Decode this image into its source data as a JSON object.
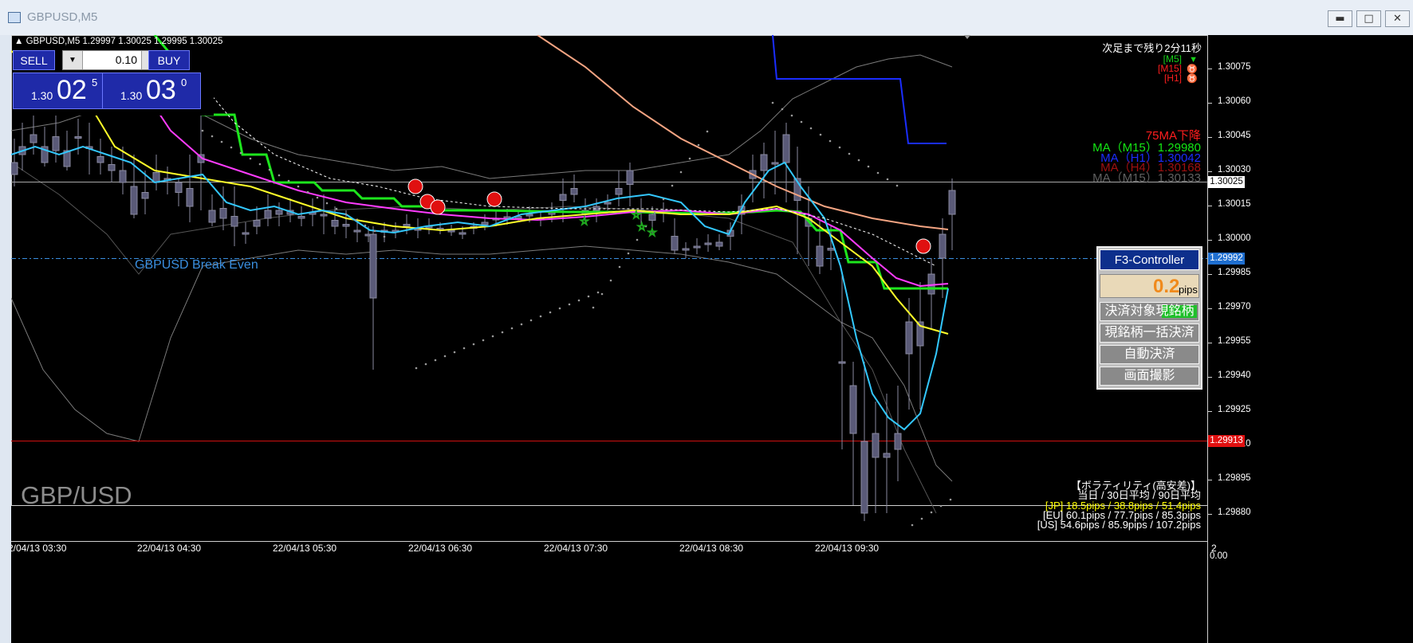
{
  "window": {
    "title": "GBPUSD,M5",
    "buttons": {
      "minimize": "▬",
      "maximize": "□",
      "close": "✕"
    }
  },
  "symbol_line": "▲ GBPUSD,M5  1.29997  1.30025  1.29995  1.30025",
  "trade_panel": {
    "sell_label": "SELL",
    "buy_label": "BUY",
    "lot": "0.10",
    "lot_down": "▼",
    "lot_up": "▲",
    "sell_price": {
      "prefix": "1.30",
      "big": "02",
      "sup": "5"
    },
    "buy_price": {
      "prefix": "1.30",
      "big": "03",
      "sup": "0"
    }
  },
  "countdown": "次足まで残り2分11秒",
  "timeframes": [
    {
      "label": "[M5]",
      "color": "#17d11a"
    },
    {
      "label": "[M15]",
      "color": "#ff1e1e"
    },
    {
      "label": "[H1]",
      "color": "#ff1e1e"
    }
  ],
  "ma_info": {
    "trend": "75MA下降",
    "lines": [
      {
        "label": "MA（M15）1.29980",
        "color": "#14e814"
      },
      {
        "label": "MA（H1）1.30042",
        "color": "#1a2dff"
      },
      {
        "label": "MA（H4）1.30168",
        "color": "#a01010"
      },
      {
        "label": "MA（M15）1.30133",
        "color": "#606060"
      }
    ]
  },
  "price_axis": {
    "labels": [
      "1.30075",
      "1.30060",
      "1.30045",
      "1.30030",
      "1.30015",
      "1.30000",
      "1.29985",
      "1.29970",
      "1.29955",
      "1.29940",
      "1.29925",
      "1.29910",
      "1.29895",
      "1.29880"
    ],
    "current": "1.30025",
    "break_even": "1.29992",
    "red_line": "1.29913",
    "bottom": "0.00"
  },
  "time_axis": [
    "2/04/13 03:30",
    "22/04/13 04:30",
    "22/04/13 05:30",
    "22/04/13 06:30",
    "22/04/13 07:30",
    "22/04/13 08:30",
    "22/04/13 09:30"
  ],
  "time_axis_right": "2",
  "break_even_label": "GBPUSD Break Even",
  "watermark": "GBP/USD",
  "f3": {
    "title": "F3-Controller",
    "pips_value": "0.2",
    "pips_unit": "pips",
    "buttons": [
      "決済対象現銘柄",
      "現銘柄一括決済",
      "自動決済",
      "画面撮影"
    ]
  },
  "volatility": {
    "heading": "【ボラティリティ(高安差)】",
    "sub": "当日 / 30日平均 / 90日平均",
    "rows": [
      {
        "label": "[JP] 18.5pips / 38.8pips / 51.4pips",
        "color": "#ffff00"
      },
      {
        "label": "[EU] 60.1pips / 77.7pips / 85.3pips",
        "color": "#ffffff"
      },
      {
        "label": "[US] 54.6pips / 85.9pips / 107.2pips",
        "color": "#ffffff"
      }
    ]
  }
}
